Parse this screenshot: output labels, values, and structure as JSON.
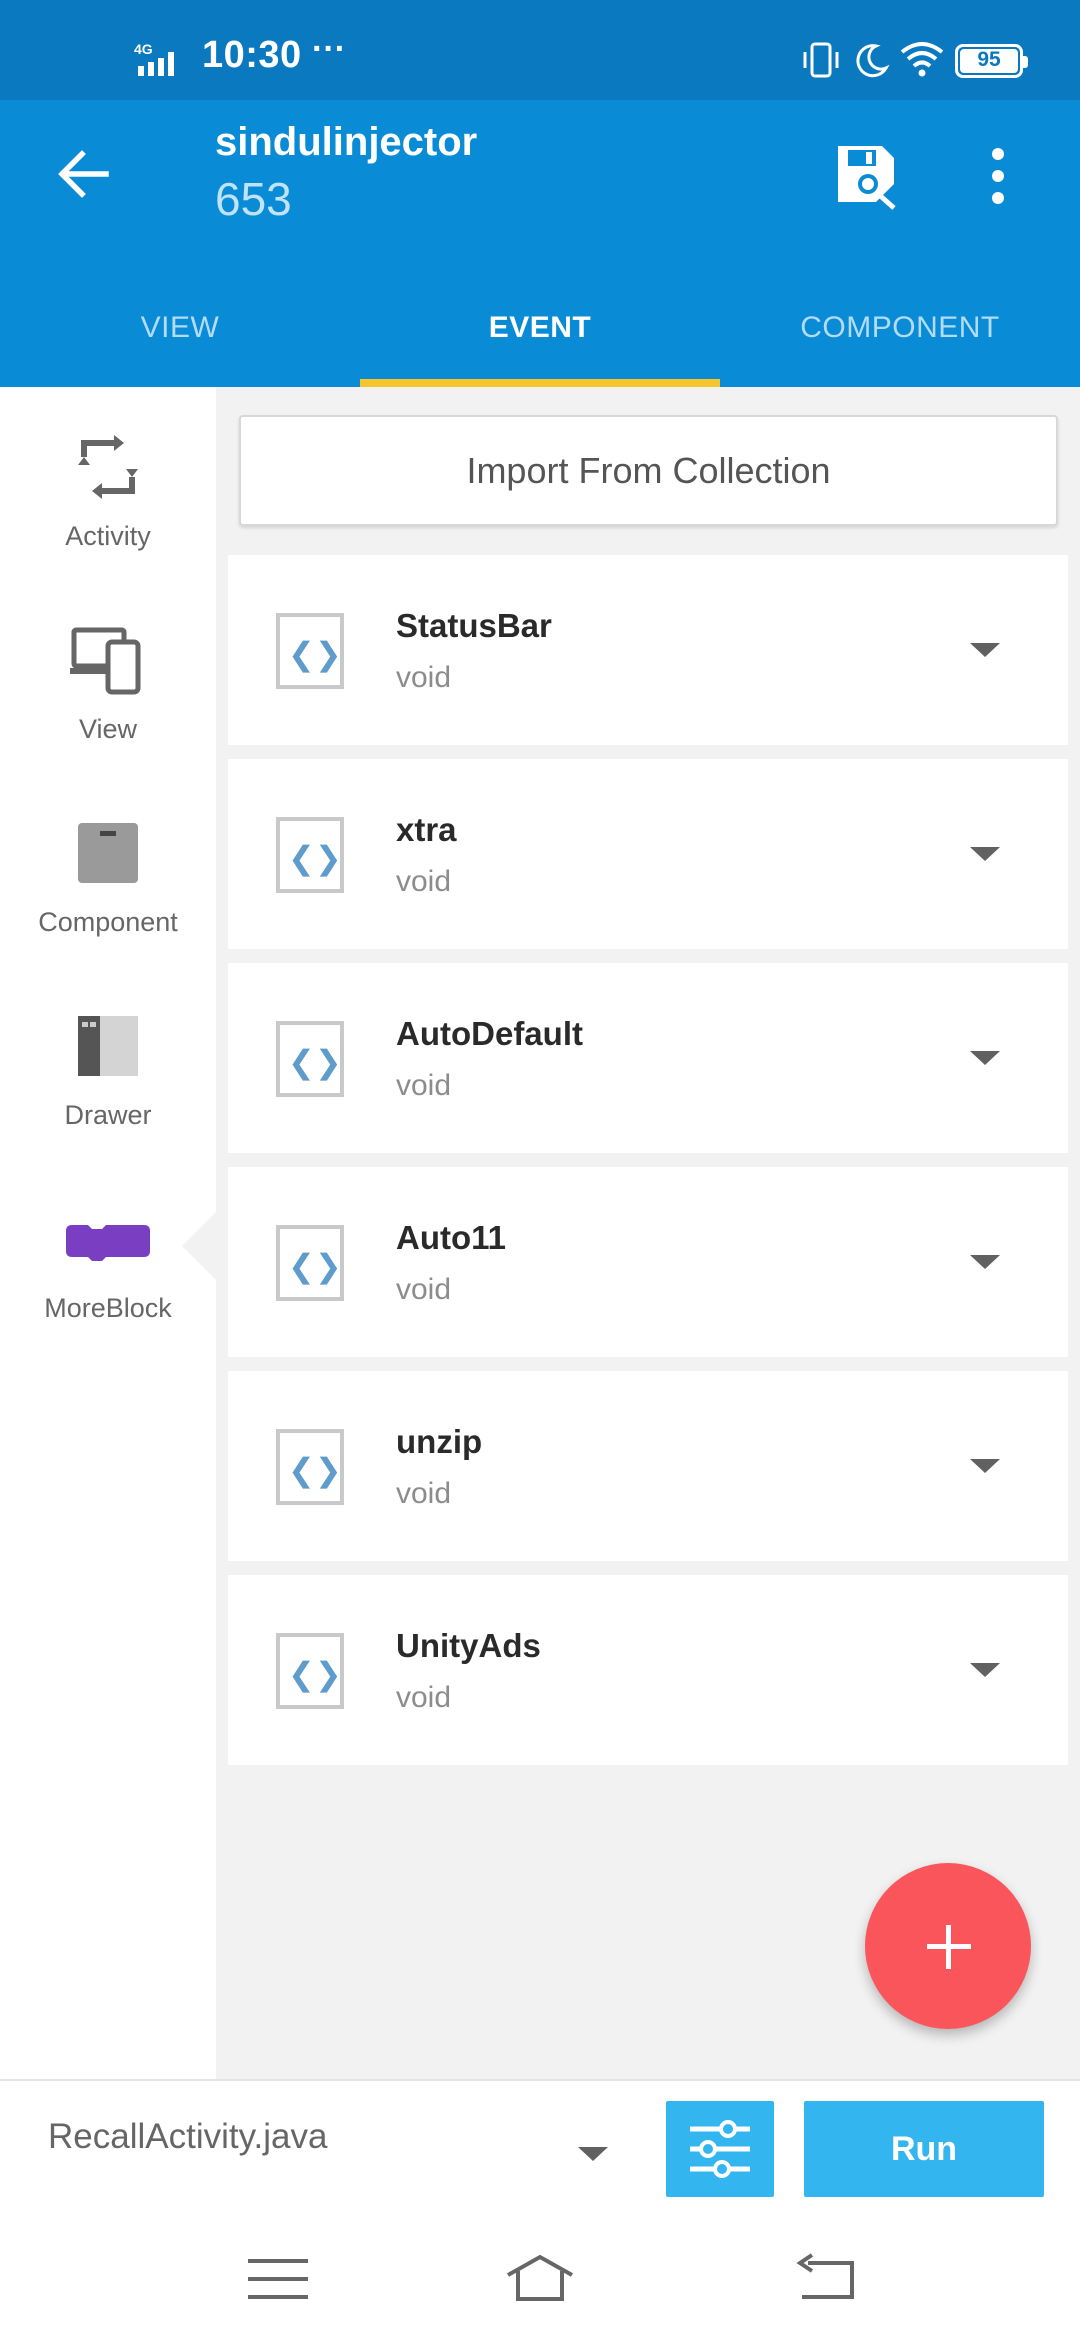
{
  "status_bar": {
    "network": "4G",
    "time": "10:30",
    "dots": "···",
    "battery": "95"
  },
  "app_bar": {
    "title": "sindulinjector",
    "subtitle": "653"
  },
  "tabs": [
    {
      "label": "VIEW",
      "active": false
    },
    {
      "label": "EVENT",
      "active": true
    },
    {
      "label": "COMPONENT",
      "active": false
    }
  ],
  "palette": [
    {
      "label": "Activity",
      "icon": "refresh-icon"
    },
    {
      "label": "View",
      "icon": "devices-icon"
    },
    {
      "label": "Component",
      "icon": "component-box-icon"
    },
    {
      "label": "Drawer",
      "icon": "drawer-icon"
    },
    {
      "label": "MoreBlock",
      "icon": "moreblock-icon",
      "color": "#7a3ec3"
    }
  ],
  "main": {
    "import_label": "Import From Collection",
    "events": [
      {
        "name": "StatusBar",
        "type": "void"
      },
      {
        "name": "xtra",
        "type": "void"
      },
      {
        "name": "AutoDefault",
        "type": "void"
      },
      {
        "name": "Auto11",
        "type": "void"
      },
      {
        "name": "unzip",
        "type": "void"
      },
      {
        "name": "UnityAds",
        "type": "void"
      }
    ],
    "code_glyph": "❮❯"
  },
  "bottom": {
    "file": "RecallActivity.java",
    "run_label": "Run"
  },
  "colors": {
    "primary": "#0a8bd6",
    "status_bar": "#0a79bf",
    "tab_indicator": "#f6c42c",
    "fab": "#f9555a",
    "button": "#33b5f0",
    "moreblock": "#7a3ec3"
  }
}
